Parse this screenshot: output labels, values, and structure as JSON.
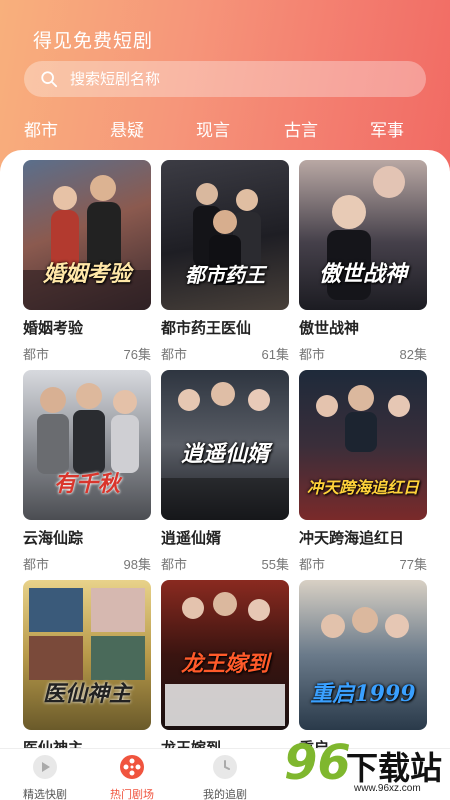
{
  "header": {
    "title": "得见免费短剧",
    "search_placeholder": "搜索短剧名称"
  },
  "categories": [
    "都市",
    "悬疑",
    "现言",
    "古言",
    "军事"
  ],
  "dramas": [
    {
      "title": "婚姻考验",
      "caption": "婚姻考验",
      "genre": "都市",
      "episodes": "76集"
    },
    {
      "title": "都市药王医仙",
      "caption": "都市药王",
      "genre": "都市",
      "episodes": "61集"
    },
    {
      "title": "傲世战神",
      "caption": "傲世战神",
      "genre": "都市",
      "episodes": "82集"
    },
    {
      "title": "云海仙踪",
      "caption": "有千秋",
      "genre": "都市",
      "episodes": "98集"
    },
    {
      "title": "逍遥仙婿",
      "caption": "逍遥仙婿",
      "genre": "都市",
      "episodes": "55集"
    },
    {
      "title": "冲天跨海追红日",
      "caption": "冲天跨海追红日",
      "genre": "都市",
      "episodes": "77集"
    },
    {
      "title": "医仙神主",
      "caption": "医仙神主",
      "genre": "",
      "episodes": ""
    },
    {
      "title": "龙王嫁到",
      "caption": "龙王嫁到",
      "genre": "",
      "episodes": ""
    },
    {
      "title": "重启",
      "caption": "重启1999",
      "genre": "",
      "episodes": ""
    }
  ],
  "tabbar": {
    "items": [
      {
        "label": "精选快剧",
        "icon": "play-icon"
      },
      {
        "label": "热门剧场",
        "icon": "film-reel-icon"
      },
      {
        "label": "我的追剧",
        "icon": "clock-icon"
      }
    ],
    "active_color": "#f0543e"
  },
  "watermark": {
    "number": "96",
    "text": "下载站",
    "url": "www.96xz.com"
  }
}
